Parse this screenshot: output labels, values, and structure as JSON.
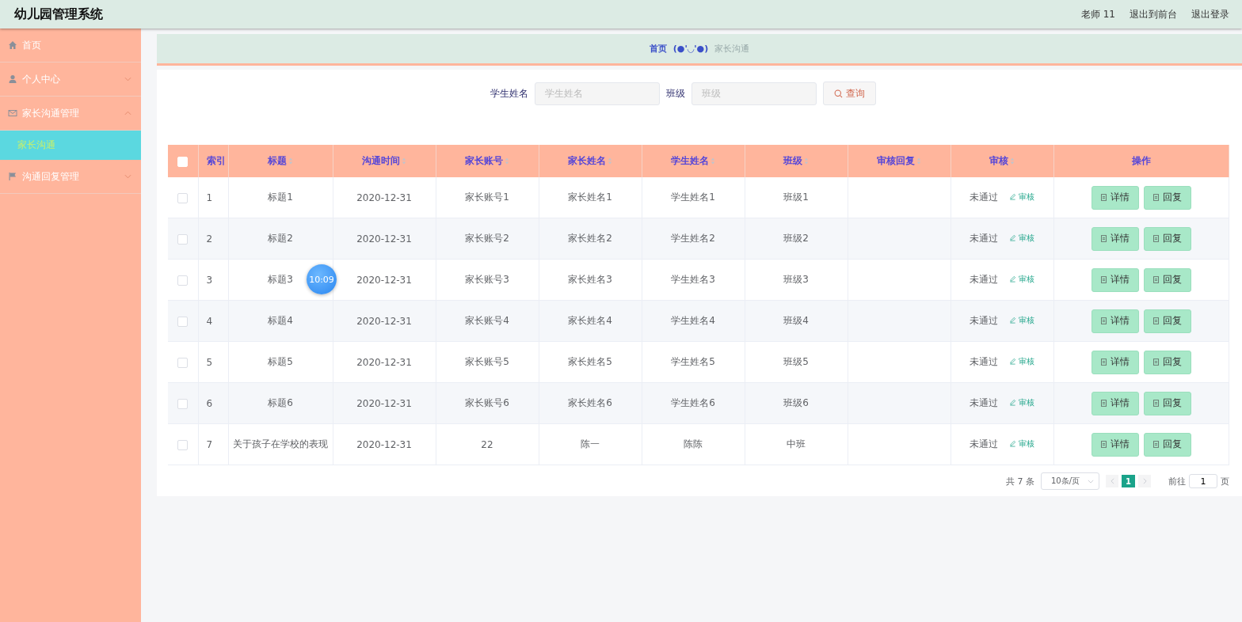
{
  "header": {
    "title": "幼儿园管理系统",
    "user": "老师 11",
    "links": [
      "退出到前台",
      "退出登录"
    ]
  },
  "sidebar": {
    "items": [
      {
        "label": "首页",
        "selected": false
      },
      {
        "label": "个人中心",
        "selected": false,
        "expanded": false
      },
      {
        "label": "家长沟通管理",
        "selected": false,
        "expanded": true,
        "children": [
          {
            "label": "家长沟通",
            "selected": true
          }
        ]
      },
      {
        "label": "沟通回复管理",
        "selected": false,
        "expanded": false
      }
    ]
  },
  "breadcrumb": {
    "items": [
      "首页",
      "家长沟通"
    ],
    "separator": "(●'◡'●)"
  },
  "search": {
    "fields": [
      {
        "label": "学生姓名",
        "placeholder": "学生姓名"
      },
      {
        "label": "班级",
        "placeholder": "班级"
      }
    ],
    "button": "查询"
  },
  "table": {
    "header_checked": false,
    "columns": [
      {
        "label": "索引",
        "sortable": false
      },
      {
        "label": "标题",
        "sortable": true
      },
      {
        "label": "沟通时间",
        "sortable": true
      },
      {
        "label": "家长账号",
        "sortable": true
      },
      {
        "label": "家长姓名",
        "sortable": true
      },
      {
        "label": "学生姓名",
        "sortable": true
      },
      {
        "label": "班级",
        "sortable": true
      },
      {
        "label": "审核回复",
        "sortable": true
      },
      {
        "label": "审核",
        "sortable": true
      },
      {
        "label": "操作",
        "sortable": false
      }
    ],
    "rows": [
      {
        "checked": false,
        "cells": [
          "1",
          "标题1",
          "2020-12-31",
          "家长账号1",
          "家长姓名1",
          "学生姓名1",
          "班级1",
          ""
        ],
        "status": "未通过",
        "review": "审核",
        "actions": [
          "详情",
          "回复"
        ]
      },
      {
        "checked": false,
        "cells": [
          "2",
          "标题2",
          "2020-12-31",
          "家长账号2",
          "家长姓名2",
          "学生姓名2",
          "班级2",
          ""
        ],
        "status": "未通过",
        "review": "审核",
        "actions": [
          "详情",
          "回复"
        ]
      },
      {
        "checked": false,
        "cells": [
          "3",
          "标题3",
          "2020-12-31",
          "家长账号3",
          "家长姓名3",
          "学生姓名3",
          "班级3",
          ""
        ],
        "status": "未通过",
        "review": "审核",
        "actions": [
          "详情",
          "回复"
        ]
      },
      {
        "checked": false,
        "cells": [
          "4",
          "标题4",
          "2020-12-31",
          "家长账号4",
          "家长姓名4",
          "学生姓名4",
          "班级4",
          ""
        ],
        "status": "未通过",
        "review": "审核",
        "actions": [
          "详情",
          "回复"
        ]
      },
      {
        "checked": false,
        "cells": [
          "5",
          "标题5",
          "2020-12-31",
          "家长账号5",
          "家长姓名5",
          "学生姓名5",
          "班级5",
          ""
        ],
        "status": "未通过",
        "review": "审核",
        "actions": [
          "详情",
          "回复"
        ]
      },
      {
        "checked": false,
        "cells": [
          "6",
          "标题6",
          "2020-12-31",
          "家长账号6",
          "家长姓名6",
          "学生姓名6",
          "班级6",
          ""
        ],
        "status": "未通过",
        "review": "审核",
        "actions": [
          "详情",
          "回复"
        ]
      },
      {
        "checked": false,
        "cells": [
          "7",
          "关于孩子在学校的表现",
          "2020-12-31",
          "22",
          "陈一",
          "陈陈",
          "中班",
          ""
        ],
        "status": "未通过",
        "review": "审核",
        "actions": [
          "详情",
          "回复"
        ]
      }
    ]
  },
  "pagination": {
    "total": "共 7 条",
    "page_size": "10条/页",
    "pages": [
      {
        "label": "1",
        "selected": true
      }
    ],
    "goto_label": "前往",
    "goto_value": "1",
    "goto_unit": "页"
  },
  "timer_bubble": "10:09"
}
